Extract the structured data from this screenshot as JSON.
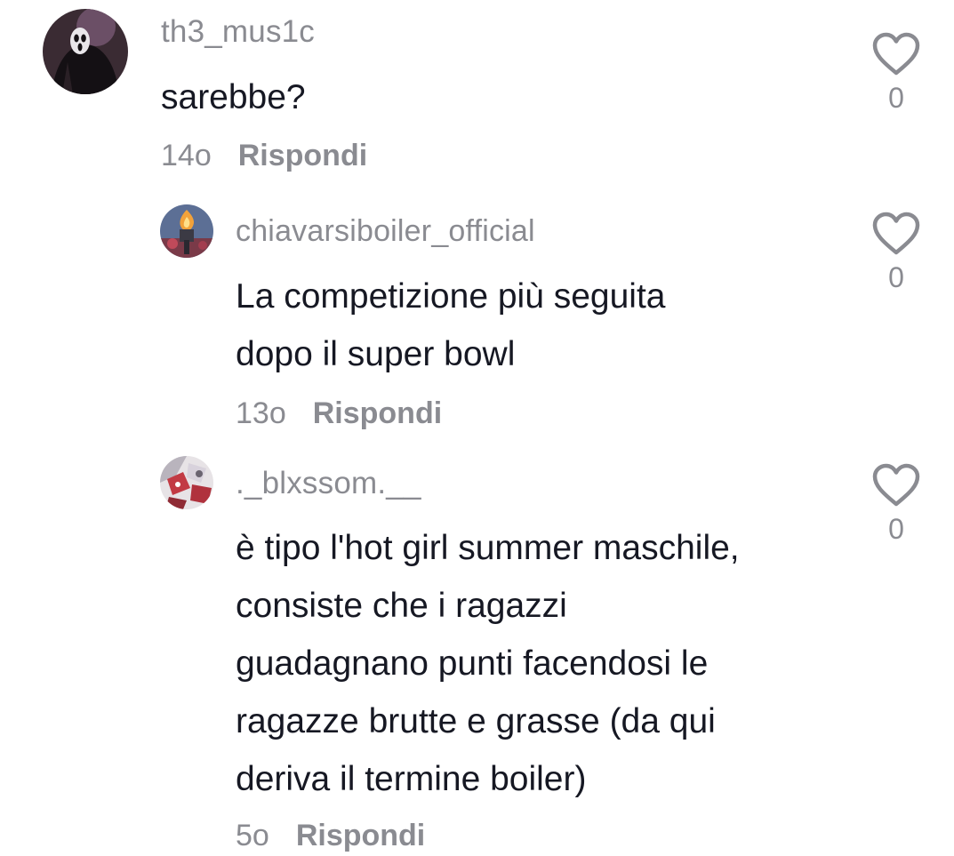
{
  "comments": [
    {
      "username": "th3_mus1c",
      "lines": [
        "sarebbe?"
      ],
      "time": "14o",
      "reply_label": "Rispondi",
      "likes": "0",
      "avatar_icon": "ghostface-avatar"
    },
    {
      "username": "chiavarsiboiler_official",
      "lines": [
        "La competizione più seguita",
        "dopo il super bowl"
      ],
      "time": "13o",
      "reply_label": "Rispondi",
      "likes": "0",
      "avatar_icon": "torch-avatar"
    },
    {
      "username": "._blxssom.__",
      "lines": [
        "è tipo l'hot girl summer maschile,",
        "consiste che i ragazzi",
        "guadagnano punti facendosi le",
        "ragazze brutte e grasse (da qui",
        "deriva il termine boiler)"
      ],
      "time": "5o",
      "reply_label": "Rispondi",
      "likes": "0",
      "avatar_icon": "collage-avatar"
    }
  ],
  "colors": {
    "text": "#161823",
    "secondary": "#8a8b91",
    "heart_stroke": "#8a8b91"
  },
  "icons": {
    "like": "heart-outline-icon"
  }
}
